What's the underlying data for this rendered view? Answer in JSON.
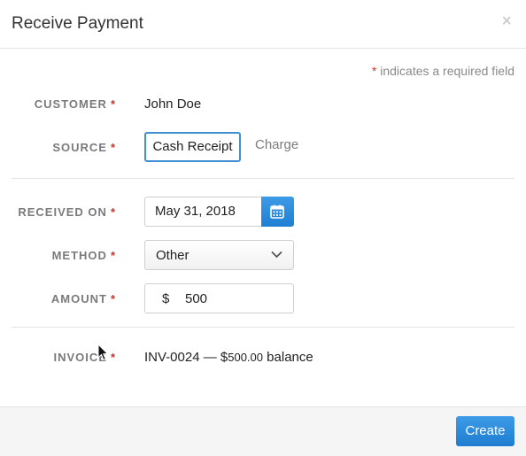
{
  "modal": {
    "title": "Receive Payment",
    "close_glyph": "×",
    "required_star": "*",
    "required_note": "indicates a required field"
  },
  "fields": {
    "customer": {
      "label": "CUSTOMER",
      "value": "John Doe"
    },
    "source": {
      "label": "SOURCE",
      "options": [
        "Cash Receipt",
        "Charge"
      ],
      "selected": "Cash Receipt"
    },
    "received_on": {
      "label": "RECEIVED ON",
      "value": "May 31, 2018",
      "icon": "calendar-icon"
    },
    "method": {
      "label": "METHOD",
      "value": "Other",
      "icon": "chevron-down-icon"
    },
    "amount": {
      "label": "AMOUNT",
      "currency": "$",
      "value": "500"
    },
    "invoice": {
      "label": "INVOICE",
      "number": "INV-0024",
      "separator": "—",
      "balance_prefix": "$",
      "balance_amount": "500.00",
      "balance_suffix": "balance"
    }
  },
  "footer": {
    "create_label": "Create"
  },
  "colors": {
    "accent": "#2a8ad9",
    "required_star": "#c0392b",
    "label": "#7a7a7a"
  }
}
